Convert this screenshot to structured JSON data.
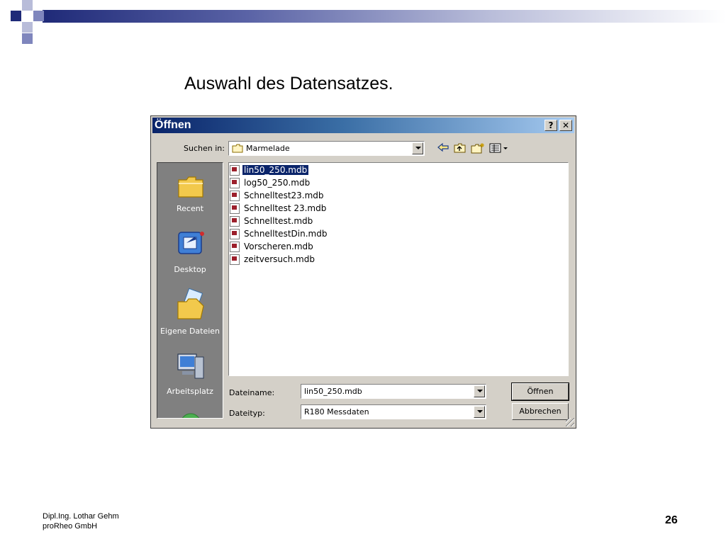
{
  "slide": {
    "title": "Auswahl des Datensatzes.",
    "footer_author": "Dipl.Ing. Lothar Gehm",
    "footer_company": "proRheo GmbH",
    "page_number": "26",
    "accent_color": "#1f2a78"
  },
  "dialog": {
    "title": "Öffnen",
    "help_label": "?",
    "close_label": "✕",
    "look_in_label": "Suchen in:",
    "look_in_value": "Marmelade",
    "toolbar": {
      "back_icon": "back-arrow-icon",
      "up_icon": "up-folder-icon",
      "new_folder_icon": "new-folder-icon",
      "views_icon": "view-menu-icon"
    },
    "places": [
      {
        "label": "Recent",
        "icon": "recent-folder-icon"
      },
      {
        "label": "Desktop",
        "icon": "desktop-icon"
      },
      {
        "label": "Eigene Dateien",
        "icon": "my-documents-icon"
      },
      {
        "label": "Arbeitsplatz",
        "icon": "my-computer-icon"
      }
    ],
    "files": [
      "lin50_250.mdb",
      "log50_250.mdb",
      "Schnelltest23.mdb",
      "Schnelltest 23.mdb",
      "Schnelltest.mdb",
      "SchnelltestDin.mdb",
      "Vorscheren.mdb",
      "zeitversuch.mdb"
    ],
    "selected_file": "lin50_250.mdb",
    "filename_label": "Dateiname:",
    "filename_value": "lin50_250.mdb",
    "filetype_label": "Dateityp:",
    "filetype_value": "R180 Messdaten",
    "open_button": "Öffnen",
    "cancel_button": "Abbrechen"
  }
}
